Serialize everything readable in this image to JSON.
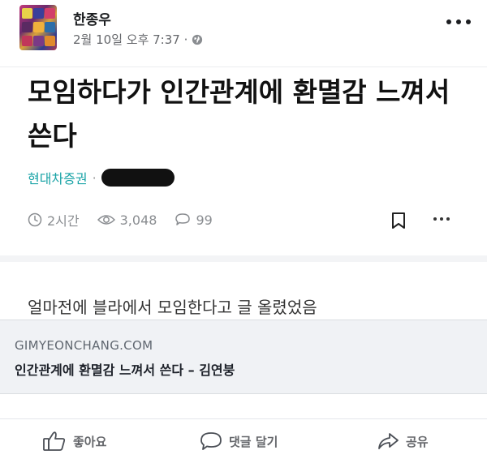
{
  "post": {
    "author": "한종우",
    "timestamp": "2월 10일 오후 7:37 ·",
    "privacy_icon": "globe-icon"
  },
  "screenshot": {
    "title": "모임하다가 인간관계에 환멸감 느껴서 쓴다",
    "company": "현대차증권",
    "separator": "·",
    "stats": {
      "time": "2시간",
      "views": "3,048",
      "comments": "99"
    },
    "body_text": "얼마전에 블라에서 모임한다고 글 올렸었음"
  },
  "link_preview": {
    "domain": "GIMYEONCHANG.COM",
    "title": "인간관계에 환멸감 느껴서 쓴다 – 김연붕"
  },
  "actions": {
    "like": "좋아요",
    "comment": "댓글 달기",
    "share": "공유"
  },
  "colors": {
    "company_accent": "#19a3a6",
    "meta_gray": "#65676b",
    "link_bg": "#f0f2f5"
  }
}
